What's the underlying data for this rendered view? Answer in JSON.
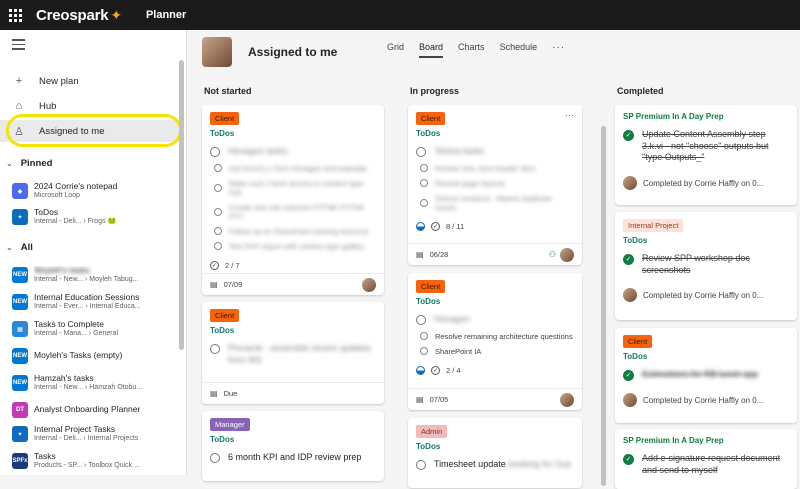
{
  "topbar": {
    "brand": "Creospark",
    "app": "Planner"
  },
  "sidebar": {
    "nav": [
      {
        "label": "New plan",
        "icon": "plus-icon"
      },
      {
        "label": "Hub",
        "icon": "home-icon"
      },
      {
        "label": "Assigned to me",
        "icon": "person-icon"
      }
    ],
    "pinned_title": "Pinned",
    "pinned": [
      {
        "name": "2024 Corrie's notepad",
        "sub": "Microsoft Loop",
        "color": "#4f6bed"
      },
      {
        "name": "ToDos",
        "sub": "Internal - Deli... › Frogs 🐸",
        "color": "#0f6cbd"
      }
    ],
    "all_title": "All",
    "plans": [
      {
        "name": "Moyleh's tasks",
        "sub": "Internal - New... › Moyleh Tabug...",
        "color": "#0078d4",
        "blur": true
      },
      {
        "name": "Internal Education Sessions",
        "sub": "Internal - Ever... › Internal Educa...",
        "color": "#0078d4",
        "blur": false
      },
      {
        "name": "Tasks to Complete",
        "sub": "Internal - Mana... › General",
        "color": "#2b88d8",
        "blur": false
      },
      {
        "name": "Moyleh's Tasks (empty)",
        "sub": "",
        "color": "#0078d4",
        "blur": "partial"
      },
      {
        "name": "Hamzah's tasks",
        "sub": "Internal - New... › Hamzah Otobu...",
        "color": "#0078d4",
        "blur": "partial"
      },
      {
        "name": "Analyst Onboarding Planner",
        "sub": "",
        "color": "#c239b3",
        "blur": false,
        "initials": "DT"
      },
      {
        "name": "Internal Project Tasks",
        "sub": "Internal - Deli... › Internal Projects",
        "color": "#0f6cbd",
        "blur": false
      },
      {
        "name": "Tasks",
        "sub": "Products - SP... › Toolbox Quick ...",
        "color": "#1b3a7a",
        "blur": false,
        "initials": "SPFx"
      }
    ]
  },
  "page": {
    "title": "Assigned to me",
    "tabs": [
      "Grid",
      "Board",
      "Charts",
      "Schedule"
    ],
    "more": "···"
  },
  "columns": {
    "not_started": {
      "title": "Not started",
      "cards": [
        {
          "label": "Client",
          "bucket": "ToDos",
          "task": "Hexagon tasks",
          "subtasks": [
            "Get term/LLL from Hexagon and populate",
            "Make sure I have access to content type hub",
            "Create new site columns PTTNK PTTNK PTT",
            "Follow up on SharePoint training resource",
            "Test PnP export with content type gallery"
          ],
          "checklist": "2 / 7",
          "due": "07/09"
        },
        {
          "label": "Client",
          "bucket": "ToDos",
          "task": "Pinnacle - assemble recent updates from MS",
          "due": "Due"
        },
        {
          "label": "Manager",
          "bucket": "ToDos",
          "task": "6 month KPI and IDP review prep"
        }
      ]
    },
    "in_progress": {
      "title": "In progress",
      "cards": [
        {
          "label": "Client",
          "bucket": "ToDos",
          "task": "Telstra tasks",
          "subtasks": [
            "Review new Java header Item",
            "Rework page layouts",
            "Search research - Marine duplicate issues"
          ],
          "checklist": "8 / 11",
          "due": "06/28"
        },
        {
          "label": "Client",
          "bucket": "ToDos",
          "task": "Hexagon",
          "subtasks": [
            "Resolve remaining architecture questions",
            "SharePoint IA"
          ],
          "checklist": "2 / 4",
          "due": "07/05"
        },
        {
          "label": "Admin",
          "bucket": "ToDos",
          "task": "Timesheet update",
          "task_blur": "booking for Sue"
        }
      ]
    },
    "completed": {
      "title": "Completed",
      "cards": [
        {
          "plan": "SP Premium In A Day Prep",
          "task": "Update Content Assembly step 3.k.vi - not \"choose\" outputs but \"type Outputs_\"",
          "completed_by": "Completed by Corrie Haffly on 0..."
        },
        {
          "label": "Internal Project",
          "bucket": "ToDos",
          "task": "Review SPP workshop doc screenshots",
          "completed_by": "Completed by Corrie Haffly on 0..."
        },
        {
          "label": "Client",
          "bucket": "ToDos",
          "task": "Estimations for RB lunch app",
          "completed_by": "Completed by Corrie Haffly on 0..."
        },
        {
          "plan": "SP Premium In A Day Prep",
          "task": "Add e-signature request document and send to myself"
        }
      ]
    }
  }
}
